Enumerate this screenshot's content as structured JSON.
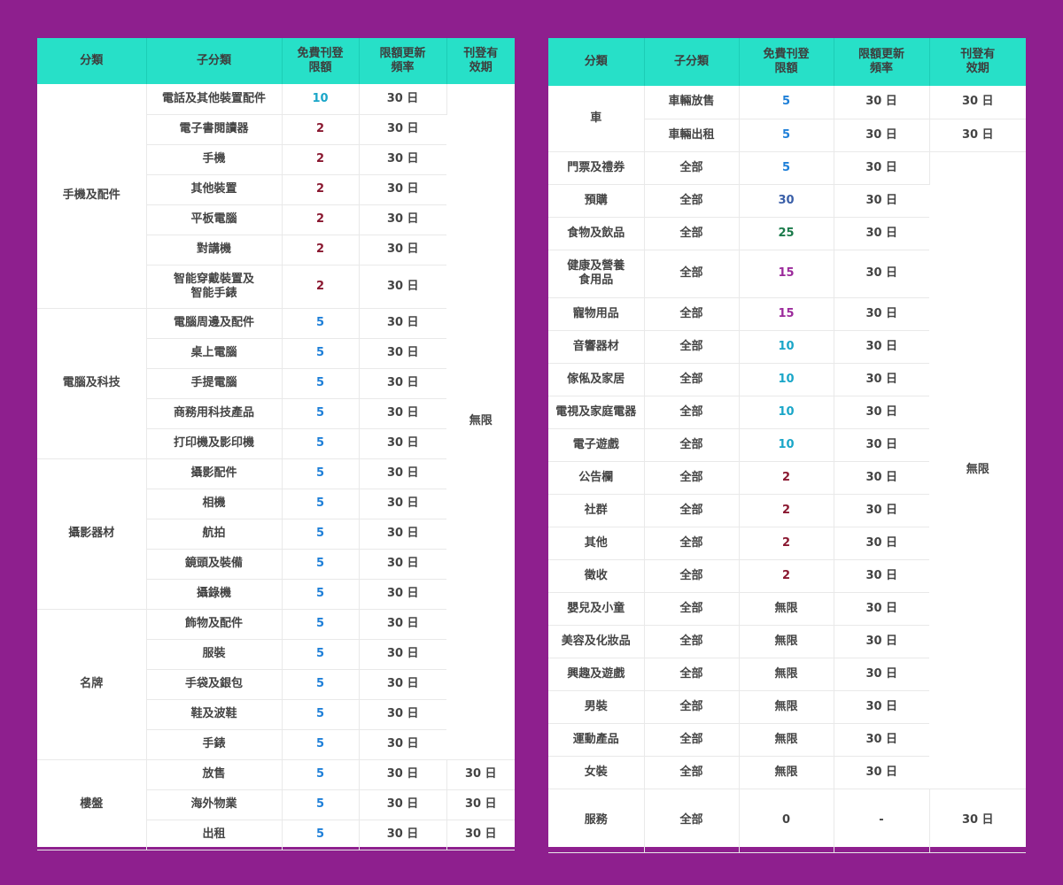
{
  "colors": {
    "background": "#8e1f8e",
    "header": "#27e0c8",
    "quota_2": "#8a1830",
    "quota_5": "#1e7fd8",
    "quota_10": "#1aa6c8",
    "quota_15": "#9b2a9b",
    "quota_25": "#1a7a4a",
    "quota_30": "#3a5fa8"
  },
  "left": {
    "headers": [
      "分類",
      "子分類",
      "免費刊登\n限額",
      "限額更新\n頻率",
      "刊登有\n效期"
    ],
    "validity_merged": "無限",
    "groups": [
      {
        "name": "手機及配件",
        "rows": [
          {
            "sub": "電話及其他裝置配件",
            "quota": "10",
            "freq": "30 日"
          },
          {
            "sub": "電子書閱讀器",
            "quota": "2",
            "freq": "30 日"
          },
          {
            "sub": "手機",
            "quota": "2",
            "freq": "30 日"
          },
          {
            "sub": "其他裝置",
            "quota": "2",
            "freq": "30 日"
          },
          {
            "sub": "平板電腦",
            "quota": "2",
            "freq": "30 日"
          },
          {
            "sub": "對講機",
            "quota": "2",
            "freq": "30 日"
          },
          {
            "sub": "智能穿戴裝置及\n智能手錶",
            "quota": "2",
            "freq": "30 日"
          }
        ]
      },
      {
        "name": "電腦及科技",
        "rows": [
          {
            "sub": "電腦周邊及配件",
            "quota": "5",
            "freq": "30 日"
          },
          {
            "sub": "桌上電腦",
            "quota": "5",
            "freq": "30 日"
          },
          {
            "sub": "手提電腦",
            "quota": "5",
            "freq": "30 日"
          },
          {
            "sub": "商務用科技產品",
            "quota": "5",
            "freq": "30 日"
          },
          {
            "sub": "打印機及影印機",
            "quota": "5",
            "freq": "30 日"
          }
        ]
      },
      {
        "name": "攝影器材",
        "rows": [
          {
            "sub": "攝影配件",
            "quota": "5",
            "freq": "30 日"
          },
          {
            "sub": "相機",
            "quota": "5",
            "freq": "30 日"
          },
          {
            "sub": "航拍",
            "quota": "5",
            "freq": "30 日"
          },
          {
            "sub": "鏡頭及裝備",
            "quota": "5",
            "freq": "30 日"
          },
          {
            "sub": "攝錄機",
            "quota": "5",
            "freq": "30 日"
          }
        ]
      },
      {
        "name": "名牌",
        "rows": [
          {
            "sub": "飾物及配件",
            "quota": "5",
            "freq": "30 日"
          },
          {
            "sub": "服裝",
            "quota": "5",
            "freq": "30 日"
          },
          {
            "sub": "手袋及銀包",
            "quota": "5",
            "freq": "30 日"
          },
          {
            "sub": "鞋及波鞋",
            "quota": "5",
            "freq": "30 日"
          },
          {
            "sub": "手錶",
            "quota": "5",
            "freq": "30 日"
          }
        ]
      },
      {
        "name": "樓盤",
        "rows": [
          {
            "sub": "放售",
            "quota": "5",
            "freq": "30 日",
            "validity": "30 日"
          },
          {
            "sub": "海外物業",
            "quota": "5",
            "freq": "30 日",
            "validity": "30 日"
          },
          {
            "sub": "出租",
            "quota": "5",
            "freq": "30 日",
            "validity": "30 日"
          }
        ]
      }
    ]
  },
  "right": {
    "headers": [
      "分類",
      "子分類",
      "免費刊登\n限額",
      "限額更新\n頻率",
      "刊登有\n效期"
    ],
    "validity_merged": "無限",
    "car": {
      "name": "車",
      "rows": [
        {
          "sub": "車輛放售",
          "quota": "5",
          "freq": "30 日",
          "validity": "30 日"
        },
        {
          "sub": "車輛出租",
          "quota": "5",
          "freq": "30 日",
          "validity": "30 日"
        }
      ]
    },
    "rows": [
      {
        "cat": "門票及禮券",
        "sub": "全部",
        "quota": "5",
        "freq": "30 日"
      },
      {
        "cat": "預購",
        "sub": "全部",
        "quota": "30",
        "freq": "30 日"
      },
      {
        "cat": "食物及飲品",
        "sub": "全部",
        "quota": "25",
        "freq": "30 日"
      },
      {
        "cat": "健康及營養\n食用品",
        "sub": "全部",
        "quota": "15",
        "freq": "30 日"
      },
      {
        "cat": "寵物用品",
        "sub": "全部",
        "quota": "15",
        "freq": "30 日"
      },
      {
        "cat": "音響器材",
        "sub": "全部",
        "quota": "10",
        "freq": "30 日"
      },
      {
        "cat": "傢俬及家居",
        "sub": "全部",
        "quota": "10",
        "freq": "30 日"
      },
      {
        "cat": "電視及家庭電器",
        "sub": "全部",
        "quota": "10",
        "freq": "30 日"
      },
      {
        "cat": "電子遊戲",
        "sub": "全部",
        "quota": "10",
        "freq": "30 日"
      },
      {
        "cat": "公告欄",
        "sub": "全部",
        "quota": "2",
        "freq": "30 日"
      },
      {
        "cat": "社群",
        "sub": "全部",
        "quota": "2",
        "freq": "30 日"
      },
      {
        "cat": "其他",
        "sub": "全部",
        "quota": "2",
        "freq": "30 日"
      },
      {
        "cat": "徵收",
        "sub": "全部",
        "quota": "2",
        "freq": "30 日"
      },
      {
        "cat": "嬰兒及小童",
        "sub": "全部",
        "quota": "無限",
        "freq": "30 日"
      },
      {
        "cat": "美容及化妝品",
        "sub": "全部",
        "quota": "無限",
        "freq": "30 日"
      },
      {
        "cat": "興趣及遊戲",
        "sub": "全部",
        "quota": "無限",
        "freq": "30 日"
      },
      {
        "cat": "男裝",
        "sub": "全部",
        "quota": "無限",
        "freq": "30 日"
      },
      {
        "cat": "運動產品",
        "sub": "全部",
        "quota": "無限",
        "freq": "30 日"
      },
      {
        "cat": "女裝",
        "sub": "全部",
        "quota": "無限",
        "freq": "30 日"
      }
    ],
    "service": {
      "cat": "服務",
      "sub": "全部",
      "quota": "0",
      "freq": "-",
      "validity": "30 日"
    }
  }
}
